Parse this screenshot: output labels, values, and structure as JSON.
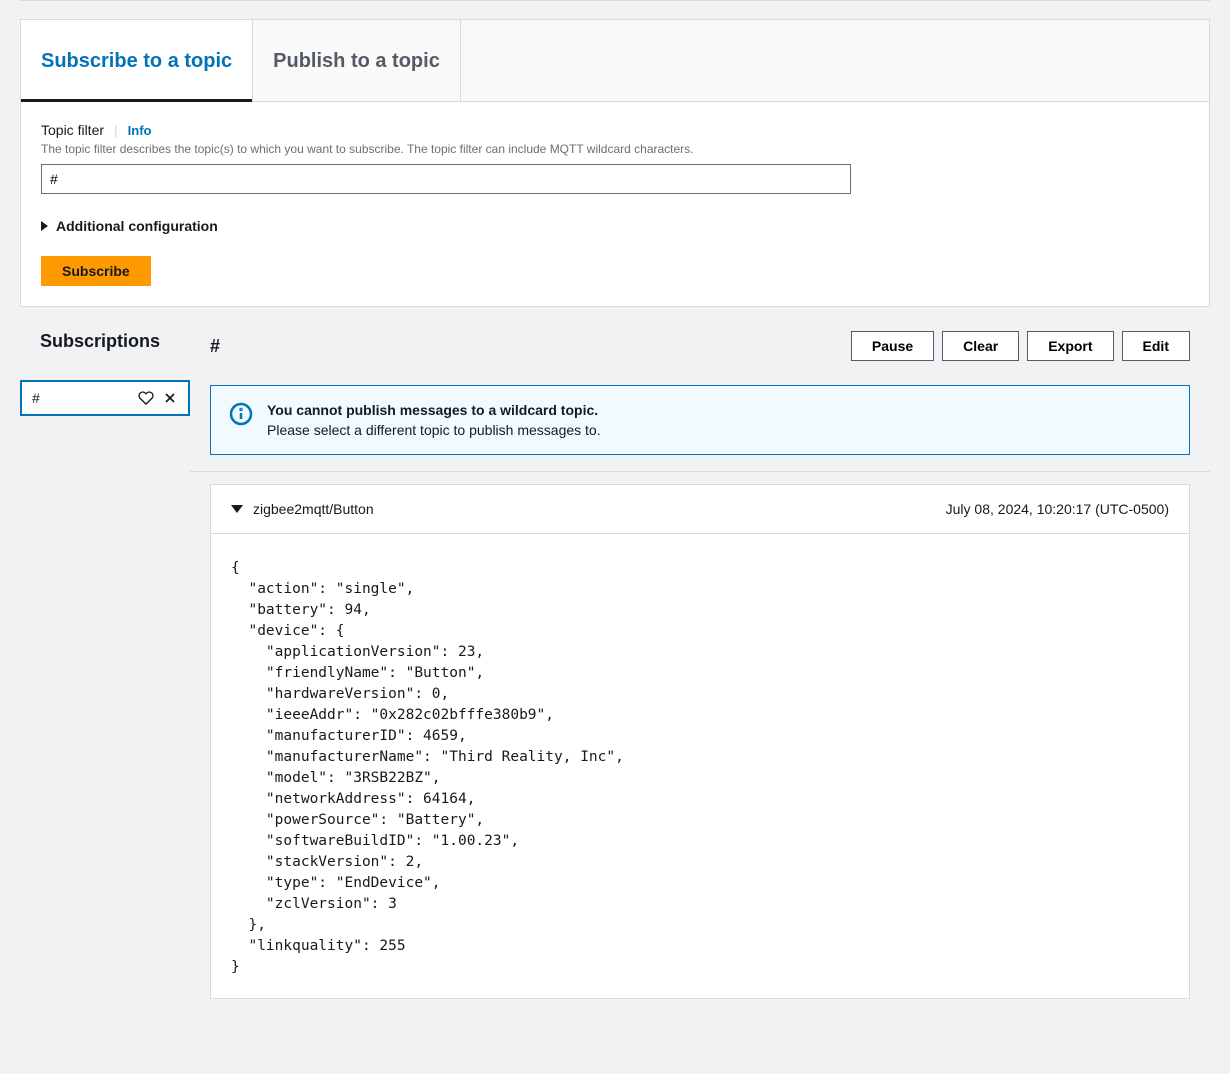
{
  "tabs": {
    "subscribe": "Subscribe to a topic",
    "publish": "Publish to a topic"
  },
  "topicFilter": {
    "label": "Topic filter",
    "infoLabel": "Info",
    "description": "The topic filter describes the topic(s) to which you want to subscribe. The topic filter can include MQTT wildcard characters.",
    "value": "#"
  },
  "additionalConfig": "Additional configuration",
  "subscribeBtn": "Subscribe",
  "subscriptions": {
    "title": "Subscriptions",
    "items": [
      {
        "topic": "#"
      }
    ]
  },
  "currentTopic": "#",
  "buttons": {
    "pause": "Pause",
    "clear": "Clear",
    "export": "Export",
    "edit": "Edit"
  },
  "alert": {
    "title": "You cannot publish messages to a wildcard topic.",
    "desc": "Please select a different topic to publish messages to."
  },
  "message": {
    "topic": "zigbee2mqtt/Button",
    "timestamp": "July 08, 2024, 10:20:17 (UTC-0500)",
    "payload": "{\n  \"action\": \"single\",\n  \"battery\": 94,\n  \"device\": {\n    \"applicationVersion\": 23,\n    \"friendlyName\": \"Button\",\n    \"hardwareVersion\": 0,\n    \"ieeeAddr\": \"0x282c02bfffe380b9\",\n    \"manufacturerID\": 4659,\n    \"manufacturerName\": \"Third Reality, Inc\",\n    \"model\": \"3RSB22BZ\",\n    \"networkAddress\": 64164,\n    \"powerSource\": \"Battery\",\n    \"softwareBuildID\": \"1.00.23\",\n    \"stackVersion\": 2,\n    \"type\": \"EndDevice\",\n    \"zclVersion\": 3\n  },\n  \"linkquality\": 255\n}"
  }
}
